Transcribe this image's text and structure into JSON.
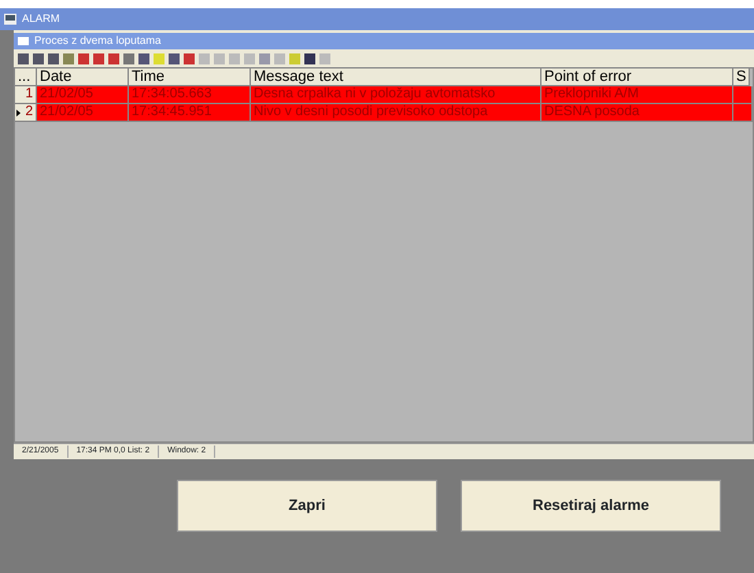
{
  "window": {
    "title": "ALARM"
  },
  "subwindow": {
    "title": "Proces z dvema loputama"
  },
  "table": {
    "columns": [
      "...",
      "Date",
      "Time",
      "Message text",
      "Point of error",
      "S"
    ],
    "rows": [
      {
        "cells": [
          "1",
          "21/02/05",
          "17:34:05.663",
          "Desna crpalka ni v položaju avtomatsko",
          "Preklopniki A/M"
        ],
        "selected": false,
        "color": "#ff0000"
      },
      {
        "cells": [
          "2",
          "21/02/05",
          "17:34:45.951",
          "Nivo v desni posodi previsoko odstopa",
          "DESNA posoda"
        ],
        "selected": true,
        "color": "#ff0000"
      }
    ]
  },
  "status_bar": [
    "2/21/2005",
    "17:34 PM 0,0 List: 2",
    "Window: 2"
  ],
  "buttons": [
    {
      "label": "Zapri"
    },
    {
      "label": "Resetiraj alarme"
    }
  ]
}
